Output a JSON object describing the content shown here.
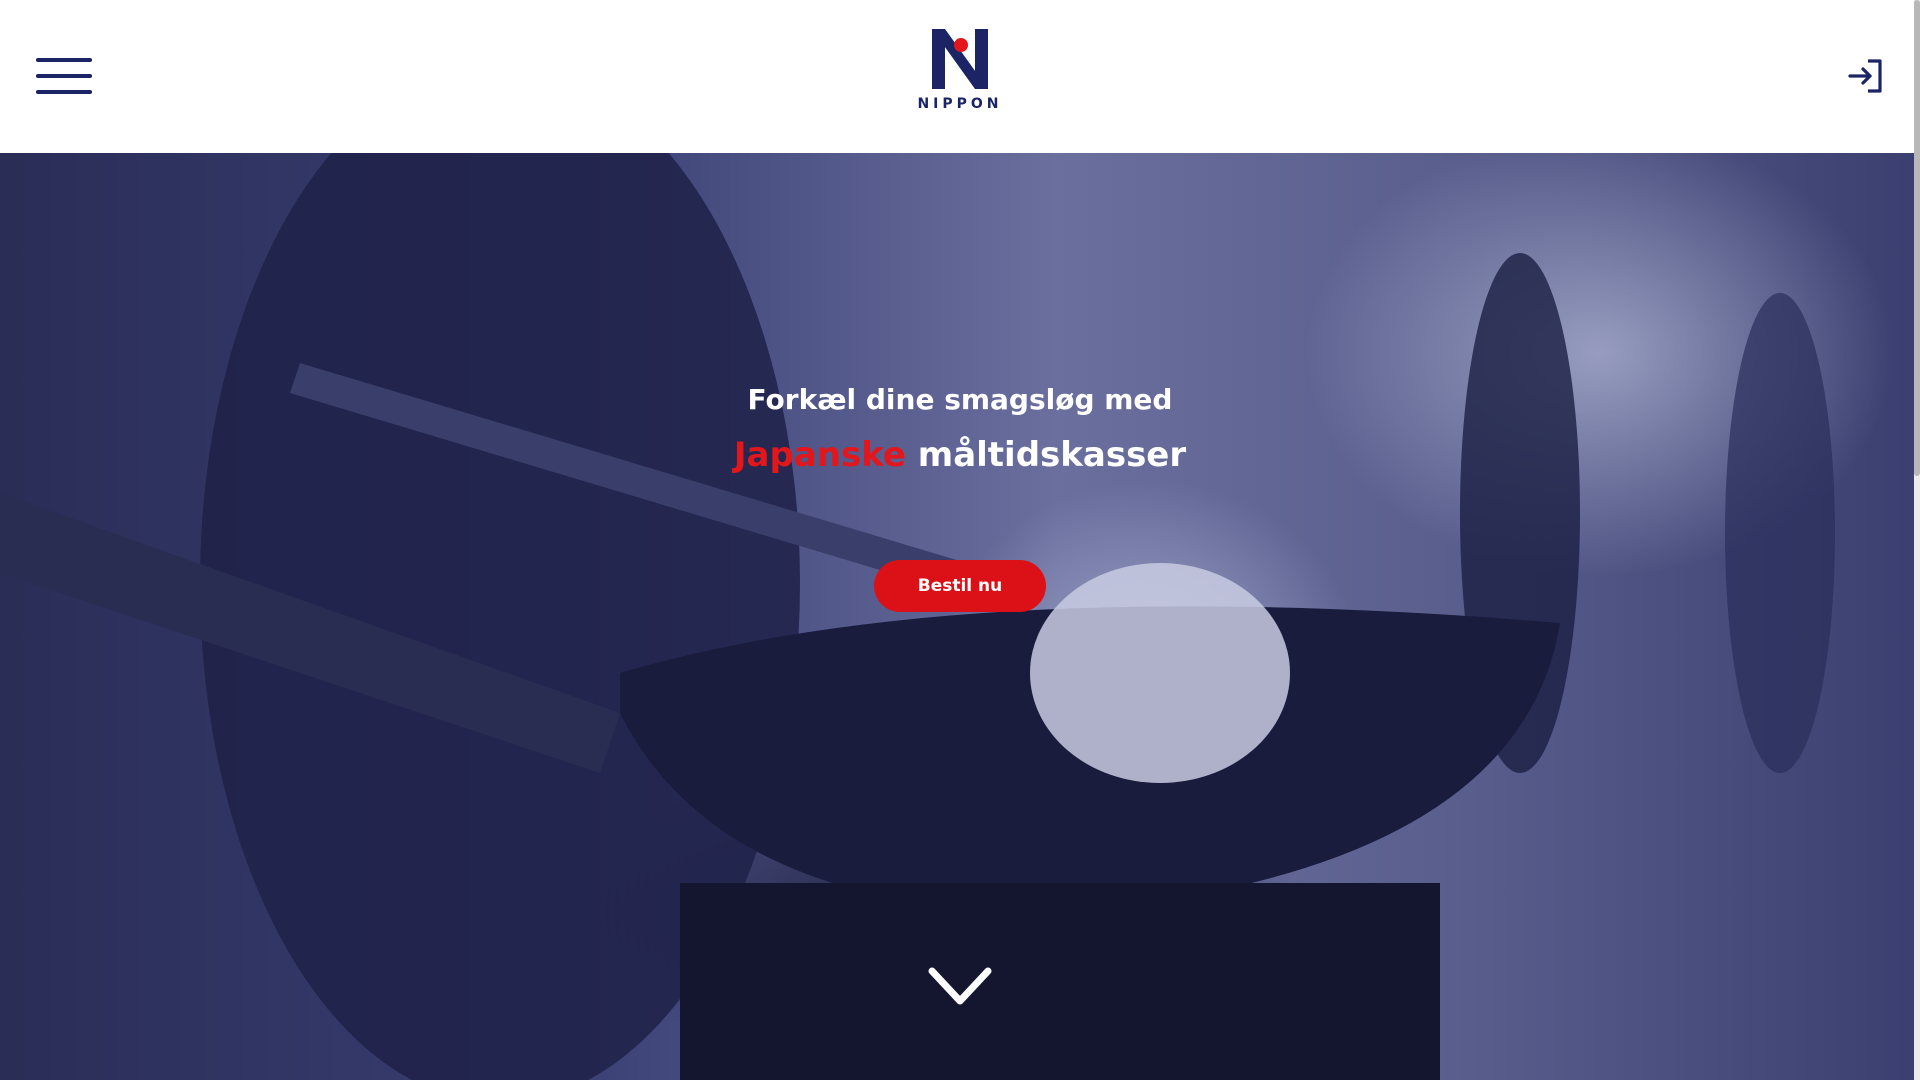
{
  "header": {
    "logo_text": "NIPPON",
    "menu_icon": "hamburger-menu-icon",
    "login_icon": "login-icon"
  },
  "hero": {
    "line1": "Forkæl dine smagsløg med",
    "line2_accent": "Japanske",
    "line2_rest": " måltidskasser",
    "cta_label": "Bestil nu",
    "scroll_icon": "chevron-down-icon"
  },
  "colors": {
    "brand_navy": "#1b2566",
    "brand_red": "#dc1118",
    "header_bg": "#ffffff"
  }
}
